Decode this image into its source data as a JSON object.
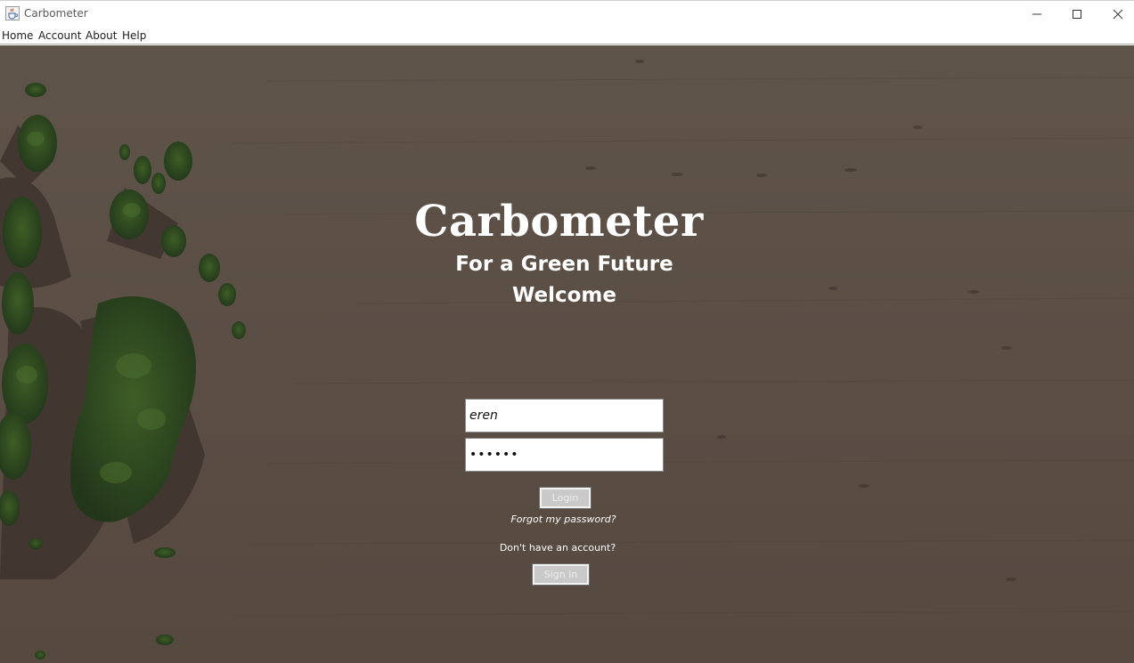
{
  "window": {
    "title": "Carbometer",
    "icon": "java-cup-icon",
    "controls": {
      "minimize": "minimize-icon",
      "maximize": "maximize-icon",
      "close": "close-icon"
    }
  },
  "menubar": {
    "items": [
      "Home",
      "Account",
      "About",
      "Help"
    ]
  },
  "login": {
    "app_title": "Carbometer",
    "tagline": "For a Green Future",
    "welcome": "Welcome",
    "username_value": "eren",
    "password_value": "••••••",
    "login_label": "Login",
    "forgot_label": "Forgot my password?",
    "no_account_text": "Don't have an account?",
    "signin_label": "Sign in"
  },
  "colors": {
    "background": "#5b4f46",
    "tree_green": "#2f4a1e",
    "text_light": "#ffffff"
  }
}
